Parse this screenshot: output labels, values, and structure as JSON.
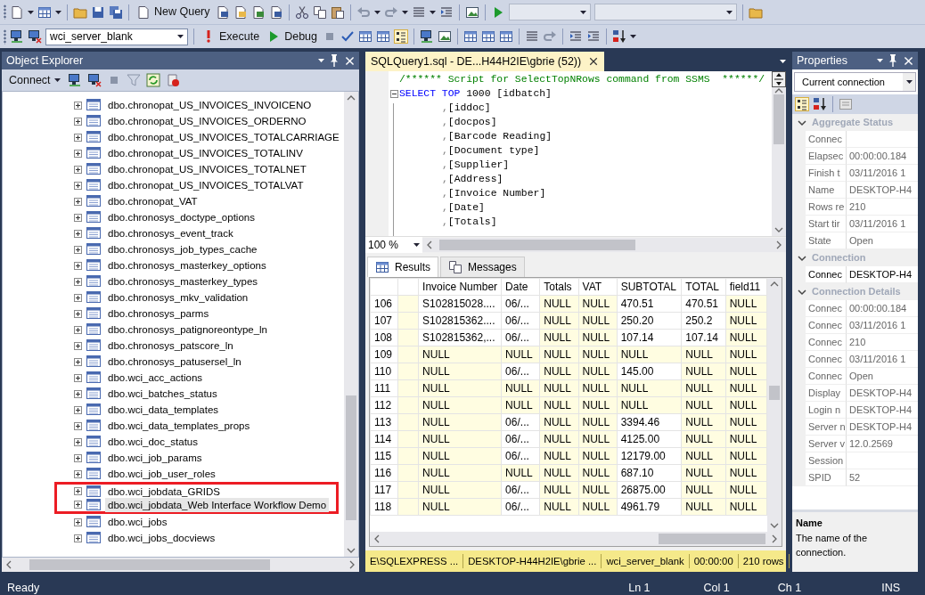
{
  "toolbar": {
    "new_query": "New Query",
    "database": "wci_server_blank",
    "execute": "Execute",
    "debug": "Debug"
  },
  "object_explorer": {
    "title": "Object Explorer",
    "connect": "Connect",
    "items": [
      {
        "label": "dbo.chronopat_US_INVOICES_INVOICENO",
        "selected": false,
        "annotated": false
      },
      {
        "label": "dbo.chronopat_US_INVOICES_ORDERNO",
        "selected": false,
        "annotated": false
      },
      {
        "label": "dbo.chronopat_US_INVOICES_TOTALCARRIAGE",
        "selected": false,
        "annotated": false
      },
      {
        "label": "dbo.chronopat_US_INVOICES_TOTALINV",
        "selected": false,
        "annotated": false
      },
      {
        "label": "dbo.chronopat_US_INVOICES_TOTALNET",
        "selected": false,
        "annotated": false
      },
      {
        "label": "dbo.chronopat_US_INVOICES_TOTALVAT",
        "selected": false,
        "annotated": false
      },
      {
        "label": "dbo.chronopat_VAT",
        "selected": false,
        "annotated": false
      },
      {
        "label": "dbo.chronosys_doctype_options",
        "selected": false,
        "annotated": false
      },
      {
        "label": "dbo.chronosys_event_track",
        "selected": false,
        "annotated": false
      },
      {
        "label": "dbo.chronosys_job_types_cache",
        "selected": false,
        "annotated": false
      },
      {
        "label": "dbo.chronosys_masterkey_options",
        "selected": false,
        "annotated": false
      },
      {
        "label": "dbo.chronosys_masterkey_types",
        "selected": false,
        "annotated": false
      },
      {
        "label": "dbo.chronosys_mkv_validation",
        "selected": false,
        "annotated": false
      },
      {
        "label": "dbo.chronosys_parms",
        "selected": false,
        "annotated": false
      },
      {
        "label": "dbo.chronosys_patignoreontype_ln",
        "selected": false,
        "annotated": false
      },
      {
        "label": "dbo.chronosys_patscore_ln",
        "selected": false,
        "annotated": false
      },
      {
        "label": "dbo.chronosys_patusersel_ln",
        "selected": false,
        "annotated": false
      },
      {
        "label": "dbo.wci_acc_actions",
        "selected": false,
        "annotated": false
      },
      {
        "label": "dbo.wci_batches_status",
        "selected": false,
        "annotated": false
      },
      {
        "label": "dbo.wci_data_templates",
        "selected": false,
        "annotated": false
      },
      {
        "label": "dbo.wci_data_templates_props",
        "selected": false,
        "annotated": false
      },
      {
        "label": "dbo.wci_doc_status",
        "selected": false,
        "annotated": false
      },
      {
        "label": "dbo.wci_job_params",
        "selected": false,
        "annotated": false
      },
      {
        "label": "dbo.wci_job_user_roles",
        "selected": false,
        "annotated": false
      },
      {
        "label": "dbo.wci_jobdata_GRIDS",
        "selected": false,
        "annotated": true
      },
      {
        "label": "dbo.wci_jobdata_Web Interface Workflow Demo",
        "selected": true,
        "annotated": true
      },
      {
        "label": "dbo.wci_jobs",
        "selected": false,
        "annotated": false
      },
      {
        "label": "dbo.wci_jobs_docviews",
        "selected": false,
        "annotated": false
      }
    ]
  },
  "editor": {
    "tab": "SQLQuery1.sql - DE...H44H2IE\\gbrie (52))",
    "zoom": "100 %",
    "lines": [
      {
        "tokens": [
          {
            "kind": "comment",
            "text": "/****** Script for SelectTopNRows command from SSMS  ******/"
          }
        ]
      },
      {
        "expanded": true,
        "tokens": [
          {
            "kind": "keyword",
            "text": "SELECT"
          },
          {
            "kind": "keyword",
            "text": " TOP"
          },
          {
            "kind": "plain",
            "text": " 1000 [idbatch]"
          }
        ]
      },
      {
        "tokens": [
          {
            "kind": "operator",
            "text": ","
          },
          {
            "kind": "plain",
            "text": "[iddoc]"
          }
        ]
      },
      {
        "tokens": [
          {
            "kind": "operator",
            "text": ","
          },
          {
            "kind": "plain",
            "text": "[docpos]"
          }
        ]
      },
      {
        "tokens": [
          {
            "kind": "operator",
            "text": ","
          },
          {
            "kind": "plain",
            "text": "[Barcode Reading]"
          }
        ]
      },
      {
        "tokens": [
          {
            "kind": "operator",
            "text": ","
          },
          {
            "kind": "plain",
            "text": "[Document type]"
          }
        ]
      },
      {
        "tokens": [
          {
            "kind": "operator",
            "text": ","
          },
          {
            "kind": "plain",
            "text": "[Supplier]"
          }
        ]
      },
      {
        "tokens": [
          {
            "kind": "operator",
            "text": ","
          },
          {
            "kind": "plain",
            "text": "[Address]"
          }
        ]
      },
      {
        "tokens": [
          {
            "kind": "operator",
            "text": ","
          },
          {
            "kind": "plain",
            "text": "[Invoice Number]"
          }
        ]
      },
      {
        "tokens": [
          {
            "kind": "operator",
            "text": ","
          },
          {
            "kind": "plain",
            "text": "[Date]"
          }
        ]
      },
      {
        "tokens": [
          {
            "kind": "operator",
            "text": ","
          },
          {
            "kind": "plain",
            "text": "[Totals]"
          }
        ]
      }
    ]
  },
  "results": {
    "tabs": [
      {
        "label": "Results",
        "selected": true
      },
      {
        "label": "Messages",
        "selected": false
      }
    ],
    "columns": [
      "Invoice Number",
      "Date",
      "Totals",
      "VAT",
      "SUBTOTAL",
      "TOTAL",
      "field11"
    ],
    "rows": [
      {
        "num": "106",
        "cells": [
          "S102815028....",
          "06/...",
          "NULL",
          "NULL",
          "470.51",
          "470.51",
          "NULL"
        ],
        "nulls": [
          false,
          false,
          true,
          true,
          false,
          false,
          true
        ]
      },
      {
        "num": "107",
        "cells": [
          "S102815362....",
          "06/...",
          "NULL",
          "NULL",
          "250.20",
          "250.2",
          "NULL"
        ],
        "nulls": [
          false,
          false,
          true,
          true,
          false,
          false,
          true
        ]
      },
      {
        "num": "108",
        "cells": [
          "S102815362,...",
          "06/...",
          "NULL",
          "NULL",
          "107.14",
          "107.14",
          "NULL"
        ],
        "nulls": [
          false,
          false,
          true,
          true,
          false,
          false,
          true
        ]
      },
      {
        "num": "109",
        "cells": [
          "NULL",
          "NULL",
          "NULL",
          "NULL",
          "NULL",
          "NULL",
          "NULL"
        ],
        "nulls": [
          true,
          true,
          true,
          true,
          true,
          true,
          true
        ]
      },
      {
        "num": "110",
        "cells": [
          "NULL",
          "06/...",
          "NULL",
          "NULL",
          "145.00",
          "NULL",
          "NULL"
        ],
        "nulls": [
          true,
          false,
          true,
          true,
          false,
          true,
          true
        ]
      },
      {
        "num": "111",
        "cells": [
          "NULL",
          "NULL",
          "NULL",
          "NULL",
          "NULL",
          "NULL",
          "NULL"
        ],
        "nulls": [
          true,
          true,
          true,
          true,
          true,
          true,
          true
        ]
      },
      {
        "num": "112",
        "cells": [
          "NULL",
          "NULL",
          "NULL",
          "NULL",
          "NULL",
          "NULL",
          "NULL"
        ],
        "nulls": [
          true,
          true,
          true,
          true,
          true,
          true,
          true
        ]
      },
      {
        "num": "113",
        "cells": [
          "NULL",
          "06/...",
          "NULL",
          "NULL",
          "3394.46",
          "NULL",
          "NULL"
        ],
        "nulls": [
          true,
          false,
          true,
          true,
          false,
          true,
          true
        ]
      },
      {
        "num": "114",
        "cells": [
          "NULL",
          "06/...",
          "NULL",
          "NULL",
          "4125.00",
          "NULL",
          "NULL"
        ],
        "nulls": [
          true,
          false,
          true,
          true,
          false,
          true,
          true
        ]
      },
      {
        "num": "115",
        "cells": [
          "NULL",
          "06/...",
          "NULL",
          "NULL",
          "12179.00",
          "NULL",
          "NULL"
        ],
        "nulls": [
          true,
          false,
          true,
          true,
          false,
          true,
          true
        ]
      },
      {
        "num": "116",
        "cells": [
          "NULL",
          "NULL",
          "NULL",
          "NULL",
          "687.10",
          "NULL",
          "NULL"
        ],
        "nulls": [
          true,
          true,
          true,
          true,
          false,
          true,
          true
        ]
      },
      {
        "num": "117",
        "cells": [
          "NULL",
          "06/...",
          "NULL",
          "NULL",
          "26875.00",
          "NULL",
          "NULL"
        ],
        "nulls": [
          true,
          false,
          true,
          true,
          false,
          true,
          true
        ]
      },
      {
        "num": "118",
        "cells": [
          "NULL",
          "06/...",
          "NULL",
          "NULL",
          "4961.79",
          "NULL",
          "NULL"
        ],
        "nulls": [
          true,
          false,
          true,
          true,
          false,
          true,
          true
        ]
      }
    ],
    "status": [
      "E\\SQLEXPRESS ...",
      "DESKTOP-H44H2IE\\gbrie ...",
      "wci_server_blank",
      "00:00:00",
      "210 rows"
    ]
  },
  "properties": {
    "title": "Properties",
    "selector": "Current connection",
    "sections": [
      {
        "title": "Aggregate Status",
        "expanded": true,
        "rows": [
          {
            "name": "Connec",
            "readonly": true
          },
          {
            "name": "Elapsec",
            "value": "00:00:00.184",
            "readonly": true
          },
          {
            "name": "Finish t",
            "value": "03/11/2016 1",
            "readonly": true
          },
          {
            "name": "Name",
            "value": "DESKTOP-H4",
            "readonly": true
          },
          {
            "name": "Rows re",
            "value": "210",
            "readonly": true
          },
          {
            "name": "Start tir",
            "value": "03/11/2016 1",
            "readonly": true
          },
          {
            "name": "State",
            "value": "Open",
            "readonly": true
          }
        ]
      },
      {
        "title": "Connection",
        "expanded": true,
        "rows": [
          {
            "name": "Connec",
            "value": "DESKTOP-H4",
            "readonly": false
          }
        ]
      },
      {
        "title": "Connection Details",
        "expanded": true,
        "rows": [
          {
            "name": "Connec",
            "value": "00:00:00.184",
            "readonly": true
          },
          {
            "name": "Connec",
            "value": "03/11/2016 1",
            "readonly": true
          },
          {
            "name": "Connec",
            "value": "210",
            "readonly": true
          },
          {
            "name": "Connec",
            "value": "03/11/2016 1",
            "readonly": true
          },
          {
            "name": "Connec",
            "value": "Open",
            "readonly": true
          },
          {
            "name": "Display",
            "value": "DESKTOP-H4",
            "readonly": true
          },
          {
            "name": "Login n",
            "value": "DESKTOP-H4",
            "readonly": true
          },
          {
            "name": "Server n",
            "value": "DESKTOP-H4",
            "readonly": true
          },
          {
            "name": "Server v",
            "value": "12.0.2569",
            "readonly": true
          },
          {
            "name": "Session",
            "readonly": true
          },
          {
            "name": "SPID",
            "value": "52",
            "readonly": true
          }
        ]
      }
    ],
    "description": {
      "title": "Name",
      "text": "The name of the connection."
    }
  },
  "status_bar": {
    "message": "Ready",
    "line": "Ln 1",
    "column": "Col 1",
    "char": "Ch 1",
    "mode": "INS"
  }
}
